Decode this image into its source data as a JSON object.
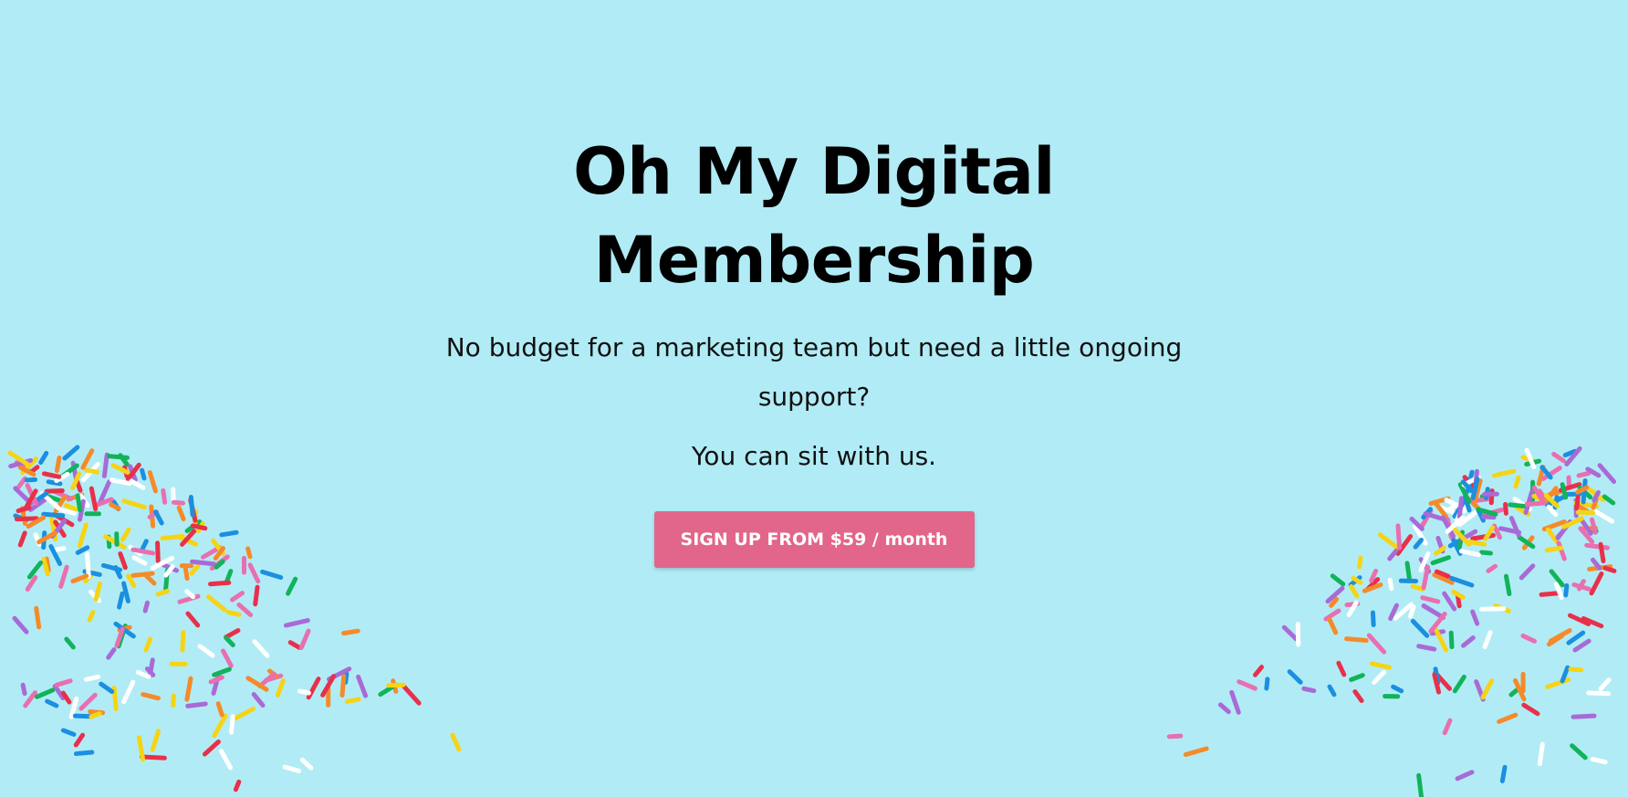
{
  "hero": {
    "title_line1": "Oh My Digital",
    "title_line2": "Membership",
    "lede": "No budget for a marketing team but need a little ongoing support?",
    "subline": "You can sit with us.",
    "cta_label": "SIGN UP FROM $59 / month"
  },
  "colors": {
    "background": "#b1ecf6",
    "cta": "#e2668a",
    "sprinkles": [
      "#e8304a",
      "#f5d415",
      "#1b8fe0",
      "#12b35a",
      "#f58a2a",
      "#e86fb0",
      "#a86bd6",
      "#ffffff"
    ]
  },
  "decor": {
    "left": "sprinkles-cluster-left",
    "right": "sprinkles-cluster-right"
  }
}
